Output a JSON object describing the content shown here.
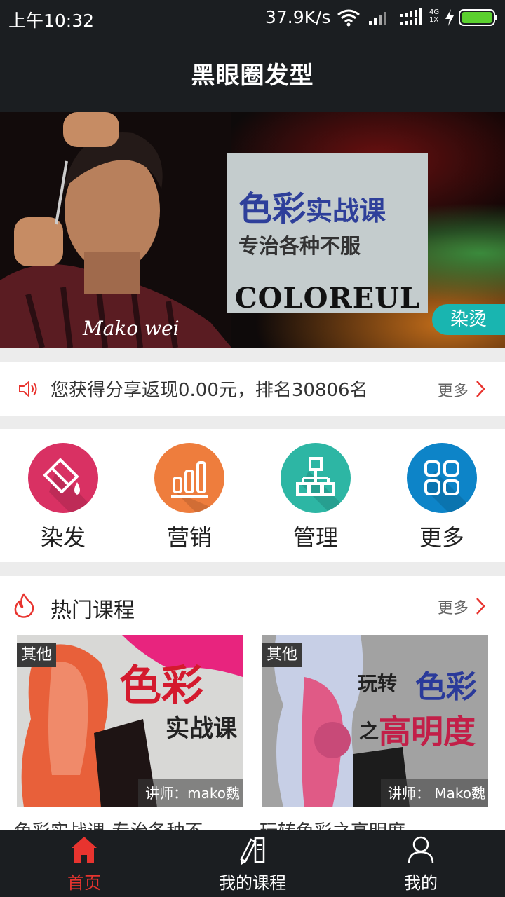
{
  "status_bar": {
    "time": "上午10:32",
    "network_speed": "37.9K/s",
    "network_labels": [
      "4G",
      "1X"
    ],
    "battery_color": "#5bd02f"
  },
  "header": {
    "title": "黑眼圈发型"
  },
  "banner": {
    "card_heading_part1": "色彩",
    "card_heading_part2": "实战课",
    "card_subheading": "专治各种不服",
    "card_wordmark": "COLOREUL",
    "signature": "Mako wei",
    "tag": "染烫"
  },
  "notice": {
    "icon": "speaker-icon",
    "text": "您获得分享返现0.00元，排名30806名",
    "more_label": "更多"
  },
  "categories": [
    {
      "label": "染发",
      "icon": "paint-bucket-icon",
      "color": "#d93163"
    },
    {
      "label": "营销",
      "icon": "bar-chart-icon",
      "color": "#ee7d3d"
    },
    {
      "label": "管理",
      "icon": "org-chart-icon",
      "color": "#2db6a4"
    },
    {
      "label": "更多",
      "icon": "grid-icon",
      "color": "#0d84c8"
    }
  ],
  "hot_courses": {
    "icon": "fire-icon",
    "title": "热门课程",
    "more_label": "更多",
    "items": [
      {
        "tag": "其他",
        "image_title_1": "色彩",
        "image_title_2": "实战课",
        "lecturer": "讲师：mako魏",
        "name": "色彩实战课-专治各种不..."
      },
      {
        "tag": "其他",
        "image_title_1": "玩转",
        "image_title_2": "色彩",
        "image_title_3": "之",
        "image_title_4": "高明度",
        "lecturer": "讲师： Mako魏",
        "name": "玩转色彩之高明度..."
      }
    ]
  },
  "bottom_nav": {
    "active_color": "#e8342f",
    "items": [
      {
        "label": "首页",
        "icon": "home-icon",
        "active": true
      },
      {
        "label": "我的课程",
        "icon": "book-pen-icon",
        "active": false
      },
      {
        "label": "我的",
        "icon": "user-icon",
        "active": false
      }
    ]
  }
}
